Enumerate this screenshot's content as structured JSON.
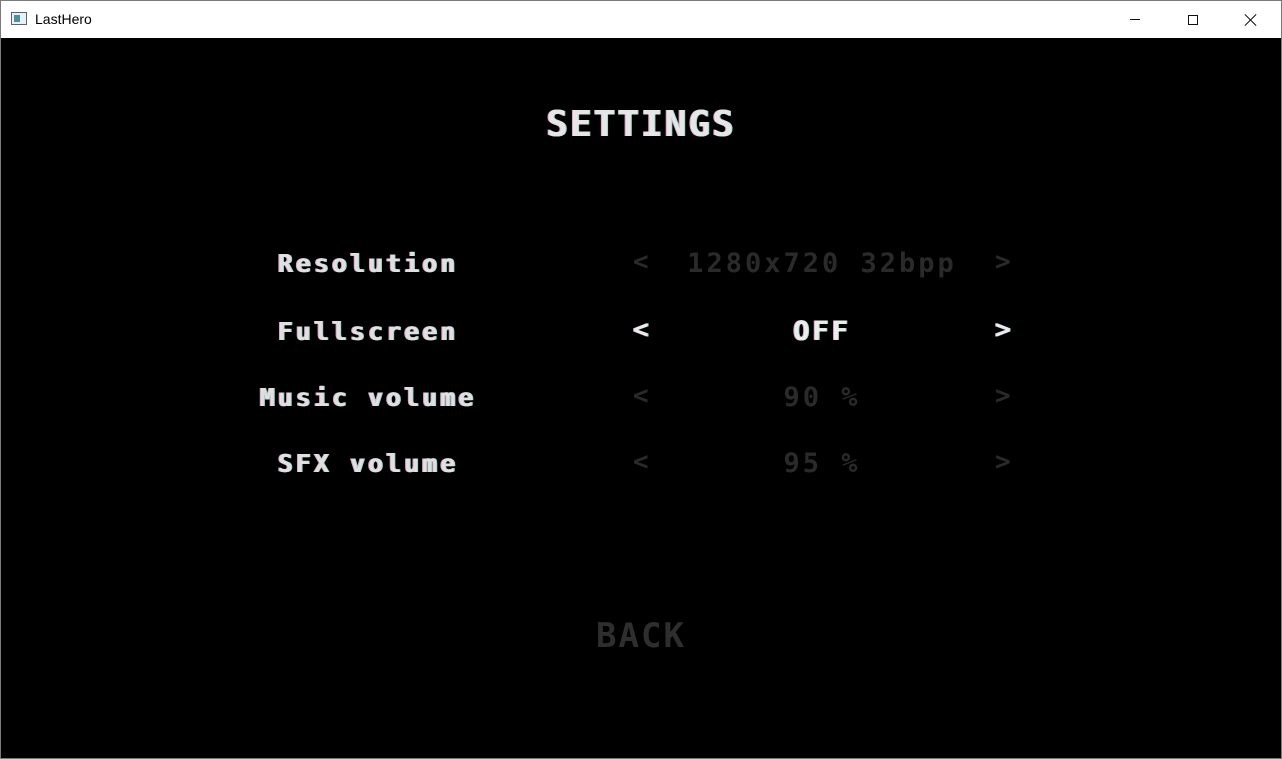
{
  "window": {
    "title": "LastHero"
  },
  "menu": {
    "heading": "SETTINGS",
    "options": [
      {
        "label": "Resolution",
        "value": "1280x720 32bpp",
        "prev_arrow": "<",
        "next_arrow": ">",
        "highlighted": false
      },
      {
        "label": "Fullscreen",
        "value": "OFF",
        "prev_arrow": "<",
        "next_arrow": ">",
        "highlighted": true
      },
      {
        "label": "Music volume",
        "value": "90 %",
        "prev_arrow": "<",
        "next_arrow": ">",
        "highlighted": false
      },
      {
        "label": "SFX volume",
        "value": "95 %",
        "prev_arrow": "<",
        "next_arrow": ">",
        "highlighted": false
      }
    ],
    "back_label": "BACK"
  },
  "colors": {
    "background": "#000000",
    "text_active": "#ececec",
    "text_inactive": "#2a2a2a",
    "titlebar": "#ffffff"
  }
}
